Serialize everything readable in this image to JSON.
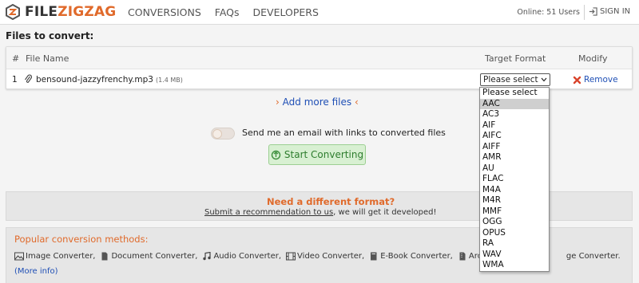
{
  "brand": {
    "file": "FILE",
    "zigzag": "ZIGZAG",
    "accent": "#e06a2b"
  },
  "nav": {
    "links": [
      "CONVERSIONS",
      "FAQs",
      "DEVELOPERS"
    ],
    "online": "Online: 51 Users",
    "signin": "SIGN IN"
  },
  "files": {
    "title": "Files to convert:",
    "columns": {
      "num": "#",
      "name": "File Name",
      "target": "Target Format",
      "modify": "Modify"
    },
    "rows": [
      {
        "num": "1",
        "name": "bensound-jazzyfrenchy.mp3",
        "size": "(1.4 MB)",
        "target": "Please select",
        "remove": "Remove"
      }
    ]
  },
  "add_more": "Add more files",
  "email": {
    "label": "Send me an email with links to converted files",
    "enabled": false
  },
  "start_button": "Start Converting",
  "different_format": {
    "title": "Need a different format?",
    "link": "Submit a recommendation to us",
    "rest": ", we will get it developed!"
  },
  "popular": {
    "title": "Popular conversion methods:",
    "items": [
      {
        "icon": "image-icon",
        "label": "Image Converter,"
      },
      {
        "icon": "document-icon",
        "label": "Document Converter,"
      },
      {
        "icon": "music-note-icon",
        "label": "Audio Converter,"
      },
      {
        "icon": "film-icon",
        "label": "Video Converter,"
      },
      {
        "icon": "book-icon",
        "label": "E-Book Converter,"
      },
      {
        "icon": "archive-icon",
        "label": "Archive Con"
      },
      {
        "icon": "",
        "label": "ge Converter."
      }
    ],
    "more_info": "(More info)"
  },
  "dropdown": {
    "selected_index": 1,
    "options": [
      "Please select",
      "AAC",
      "AC3",
      "AIF",
      "AIFC",
      "AIFF",
      "AMR",
      "AU",
      "FLAC",
      "M4A",
      "M4R",
      "MMF",
      "OGG",
      "OPUS",
      "RA",
      "WAV",
      "WMA"
    ]
  }
}
